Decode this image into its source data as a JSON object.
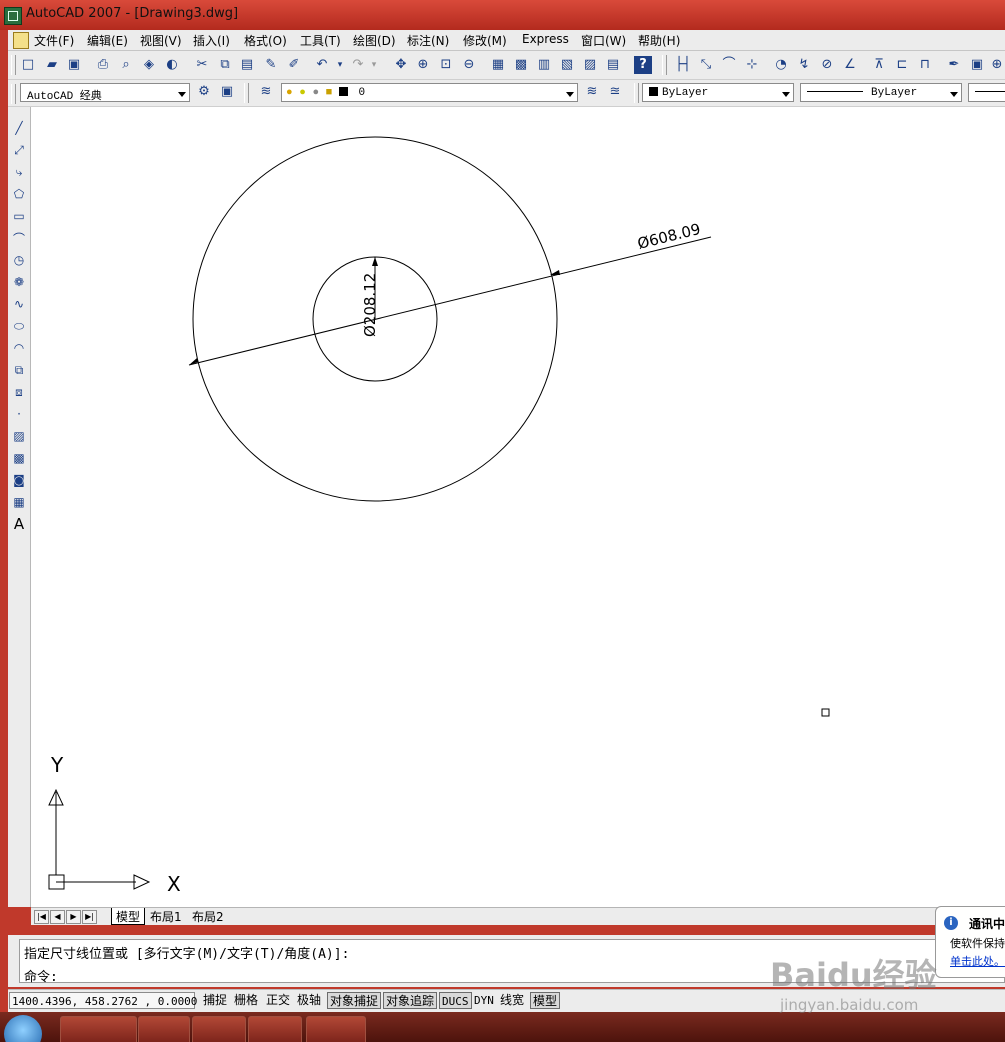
{
  "window": {
    "title": "AutoCAD 2007 - [Drawing3.dwg]"
  },
  "menu": [
    "文件(F)",
    "编辑(E)",
    "视图(V)",
    "插入(I)",
    "格式(O)",
    "工具(T)",
    "绘图(D)",
    "标注(N)",
    "修改(M)",
    "Express",
    "窗口(W)",
    "帮助(H)"
  ],
  "toolbar": {
    "workspace": "AutoCAD 经典",
    "layer": "0",
    "color": "ByLayer",
    "linetype": "ByLayer"
  },
  "drawing": {
    "dim_outer": "Ø608.09",
    "dim_inner": "Ø208.12",
    "ucs_y": "Y",
    "ucs_x": "X"
  },
  "tabs": [
    "模型",
    "布局1",
    "布局2"
  ],
  "command": {
    "line1": "指定尺寸线位置或 [多行文字(M)/文字(T)/角度(A)]:",
    "line2": "命令:"
  },
  "status": {
    "coords": "1400.4396, 458.2762 , 0.0000",
    "buttons": [
      "捕捉",
      "栅格",
      "正交",
      "极轴",
      "对象捕捉",
      "对象追踪",
      "DUCS",
      "DYN",
      "线宽",
      "模型"
    ]
  },
  "balloon": {
    "title": "通讯中",
    "text": "使软件保持",
    "link": "单击此处。"
  },
  "watermark": {
    "logo": "Baidu经验",
    "url": "jingyan.baidu.com"
  }
}
